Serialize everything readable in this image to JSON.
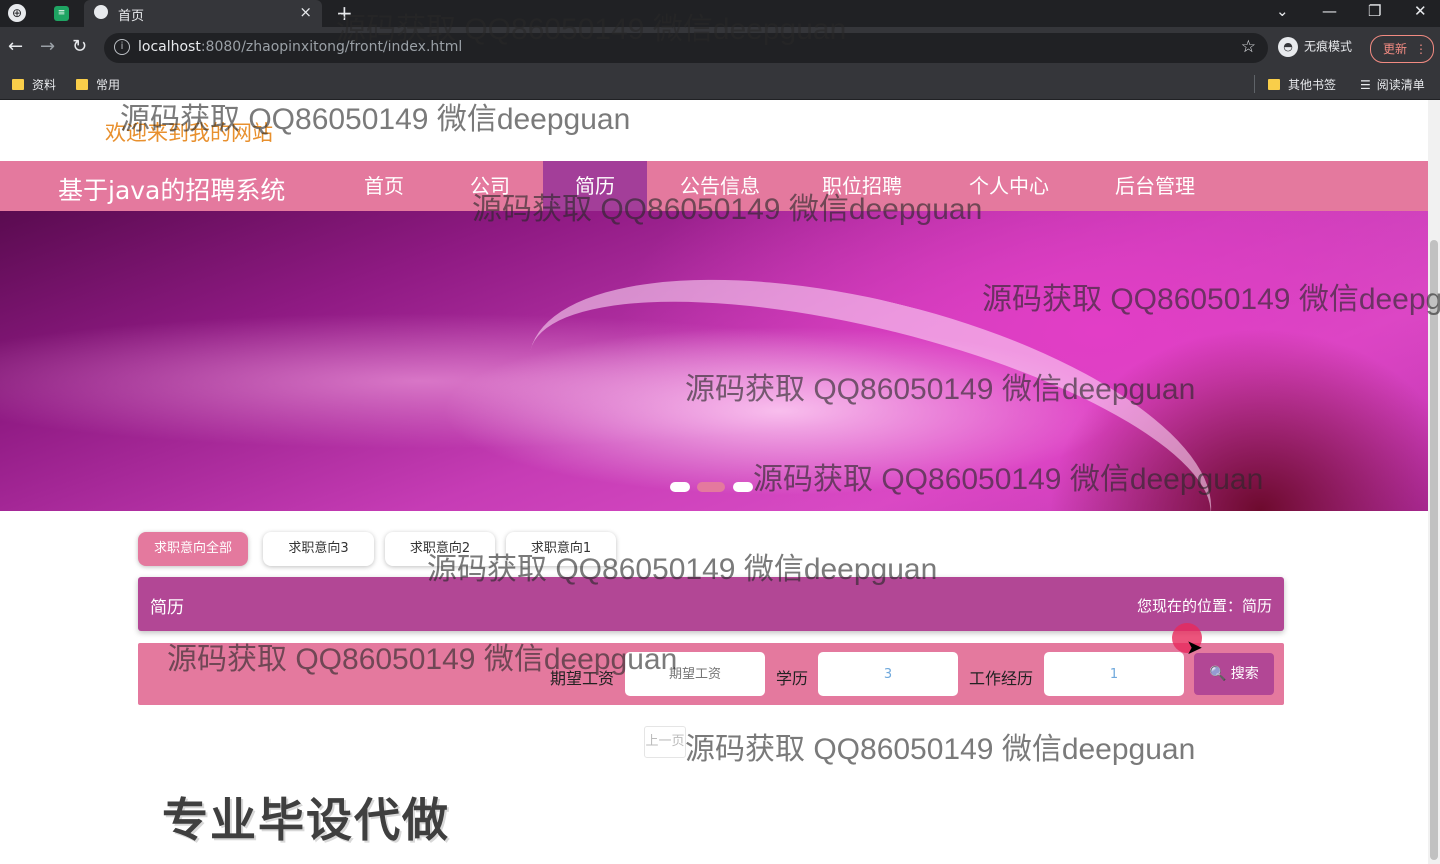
{
  "browser": {
    "tab_title": "首页",
    "tab_close": "×",
    "new_tab": "+",
    "url_host": "localhost",
    "url_rest": ":8080/zhaopinxitong/front/index.html",
    "incognito_label": "无痕模式",
    "update_label": "更新",
    "bookmarks": [
      "资料",
      "常用"
    ],
    "other_bookmarks": "其他书签",
    "reading_list": "阅读清单",
    "win_minimize": "—",
    "win_restore": "❐",
    "win_close": "✕",
    "nav_back": "←",
    "nav_forward": "→",
    "nav_reload": "↻",
    "info_glyph": "i",
    "star_glyph": "☆",
    "tab_search_glyph": "⌄",
    "kebab_glyph": "⋮",
    "reading_list_glyph": "☰"
  },
  "site": {
    "welcome": "欢迎来到我的网站",
    "brand": "基于java的招聘系统",
    "nav": [
      "首页",
      "公司",
      "简历",
      "公告信息",
      "职位招聘",
      "个人中心",
      "后台管理"
    ],
    "active_nav": "简历"
  },
  "filters": [
    "求职意向全部",
    "求职意向3",
    "求职意向2",
    "求职意向1"
  ],
  "crumb": {
    "title": "简历",
    "location": "您现在的位置：简历"
  },
  "search": {
    "salary_label": "期望工资",
    "salary_placeholder": "期望工资",
    "education_label": "学历",
    "education_value": "3",
    "experience_label": "工作经历",
    "experience_value": "1",
    "button_label": "搜索",
    "button_icon": "🔍"
  },
  "pager": {
    "prev_label": "上一页"
  },
  "promo": "专业毕设代做",
  "watermark": "源码获取 QQ86050149 微信deepguan",
  "colors": {
    "nav_bar": "#e4799e",
    "nav_active": "#a33e99",
    "crumb_bar": "#b24795",
    "welcome_text": "#e8902e"
  }
}
